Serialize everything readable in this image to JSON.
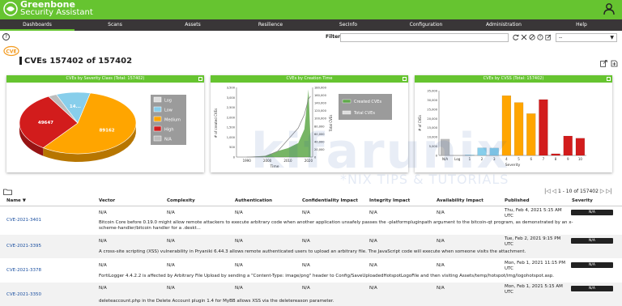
{
  "header": {
    "brand_line1": "Greenbone",
    "brand_line2": "Security Assistant"
  },
  "nav": {
    "items": [
      "Dashboards",
      "Scans",
      "Assets",
      "Resilience",
      "SecInfo",
      "Configuration",
      "Administration",
      "Help"
    ],
    "active": "Dashboards"
  },
  "toolbar": {
    "help_label": "?",
    "filter_label": "Filter",
    "filter_value": "",
    "select_value": "--"
  },
  "page": {
    "title": "CVEs 157402 of 157402"
  },
  "charts": {
    "severity_title": "CVEs by Severity Class (Total: 157402)",
    "creation_title": "CVEs by Creation Time",
    "cvss_title": "CVEs by CVSS (Total: 157402)"
  },
  "chart_data": [
    {
      "type": "pie",
      "title": "CVEs by Severity Class (Total: 157402)",
      "labels": [
        "Log",
        "Low",
        "Medium",
        "High",
        "N/A"
      ],
      "values": [
        0,
        14900,
        89162,
        49647,
        3693
      ],
      "data_labels": [
        "49647",
        "89162",
        "14..."
      ],
      "colors": [
        "#dddddd",
        "#87ceeb",
        "#ffa500",
        "#d21c1c",
        "#bcbcbc"
      ],
      "legend": "right"
    },
    {
      "type": "area",
      "title": "CVEs by Creation Time",
      "xlabel": "Time",
      "ylabel_left": "# of created CVEs",
      "ylabel_right": "Total CVEs",
      "x_ticks": [
        "1990",
        "2000",
        "2010",
        "2020"
      ],
      "y_ticks_left": [
        "0",
        "500",
        "1,000",
        "1,500",
        "2,000",
        "2,500",
        "3,000",
        "3,500"
      ],
      "y_ticks_right": [
        "0",
        "20,000",
        "40,000",
        "60,000",
        "80,000",
        "100,000",
        "120,000",
        "140,000",
        "160,000",
        "180,000"
      ],
      "series": [
        {
          "name": "Created CVEs",
          "x": [
            1990,
            1999,
            2005,
            2010,
            2015,
            2018,
            2020,
            2021
          ],
          "values": [
            0,
            60,
            300,
            450,
            700,
            1400,
            3400,
            800
          ]
        },
        {
          "name": "Total CVEs",
          "x": [
            1990,
            1999,
            2005,
            2010,
            2015,
            2018,
            2020,
            2021
          ],
          "values": [
            0,
            1500,
            15000,
            45000,
            75000,
            110000,
            150000,
            157402
          ]
        }
      ],
      "legend": "top-right"
    },
    {
      "type": "bar",
      "title": "CVEs by CVSS (Total: 157402)",
      "xlabel": "Severity",
      "ylabel": "# of CVEs",
      "categories": [
        "N/A",
        "Log",
        "1",
        "2",
        "3",
        "4",
        "5",
        "6",
        "7",
        "8",
        "9",
        "10"
      ],
      "values": [
        8800,
        200,
        300,
        4100,
        4000,
        32300,
        28600,
        22600,
        30200,
        900,
        10500,
        9300
      ],
      "colors": [
        "#bcbcbc",
        "#dddddd",
        "#87ceeb",
        "#87ceeb",
        "#87ceeb",
        "#ffa500",
        "#ffa500",
        "#ffa500",
        "#d21c1c",
        "#d21c1c",
        "#d21c1c",
        "#d21c1c"
      ],
      "y_ticks": [
        "0",
        "5,000",
        "10,000",
        "15,000",
        "20,000",
        "25,000",
        "30,000",
        "35,000"
      ],
      "ylim": [
        0,
        35000
      ]
    }
  ],
  "pagination": {
    "text": "1 - 10 of 157402"
  },
  "table": {
    "headers": [
      "Name ▼",
      "Vector",
      "Complexity",
      "Authentication",
      "Confidentiality Impact",
      "Integrity Impact",
      "Availability Impact",
      "Published",
      "Severity"
    ],
    "rows": [
      {
        "name": "CVE-2021-3401",
        "vector": "N/A",
        "complexity": "N/A",
        "authentication": "N/A",
        "confidentiality": "N/A",
        "integrity": "N/A",
        "availability": "N/A",
        "published": "Thu, Feb 4, 2021 5:15 AM UTC",
        "severity": "N/A",
        "description": "Bitcoin Core before 0.19.0 might allow remote attackers to execute arbitrary code when another application unsafely passes the -platformpluginpath argument to the bitcoin-qt program, as demonstrated by an x-scheme-handler/bitcoin handler for a .deskt..."
      },
      {
        "name": "CVE-2021-3395",
        "vector": "N/A",
        "complexity": "N/A",
        "authentication": "N/A",
        "confidentiality": "N/A",
        "integrity": "N/A",
        "availability": "N/A",
        "published": "Tue, Feb 2, 2021 9:15 PM UTC",
        "severity": "N/A",
        "description": "A cross-site scripting (XSS) vulnerability in Pryaniki 6.44.3 allows remote authenticated users to upload an arbitrary file. The JavaScript code will execute when someone visits the attachment."
      },
      {
        "name": "CVE-2021-3378",
        "vector": "N/A",
        "complexity": "N/A",
        "authentication": "N/A",
        "confidentiality": "N/A",
        "integrity": "N/A",
        "availability": "N/A",
        "published": "Mon, Feb 1, 2021 11:15 PM UTC",
        "severity": "N/A",
        "description": "FortiLogger 4.4.2.2 is affected by Arbitrary File Upload by sending a \"Content-Type: image/png\" header to Config/SaveUploadedHotspotLogoFile and then visiting Assets/temp/hotspot/img/logohotspot.asp."
      },
      {
        "name": "CVE-2021-3350",
        "vector": "N/A",
        "complexity": "N/A",
        "authentication": "N/A",
        "confidentiality": "N/A",
        "integrity": "N/A",
        "availability": "N/A",
        "published": "Mon, Feb 1, 2021 5:15 AM UTC",
        "severity": "N/A",
        "description": "deleteaccount.php in the Delete Account plugin 1.4 for MyBB allows XSS via the deletereason parameter."
      }
    ]
  },
  "watermark": {
    "text": "kifarunix",
    "tagline": "*NIX TIPS & TUTORIALS"
  }
}
